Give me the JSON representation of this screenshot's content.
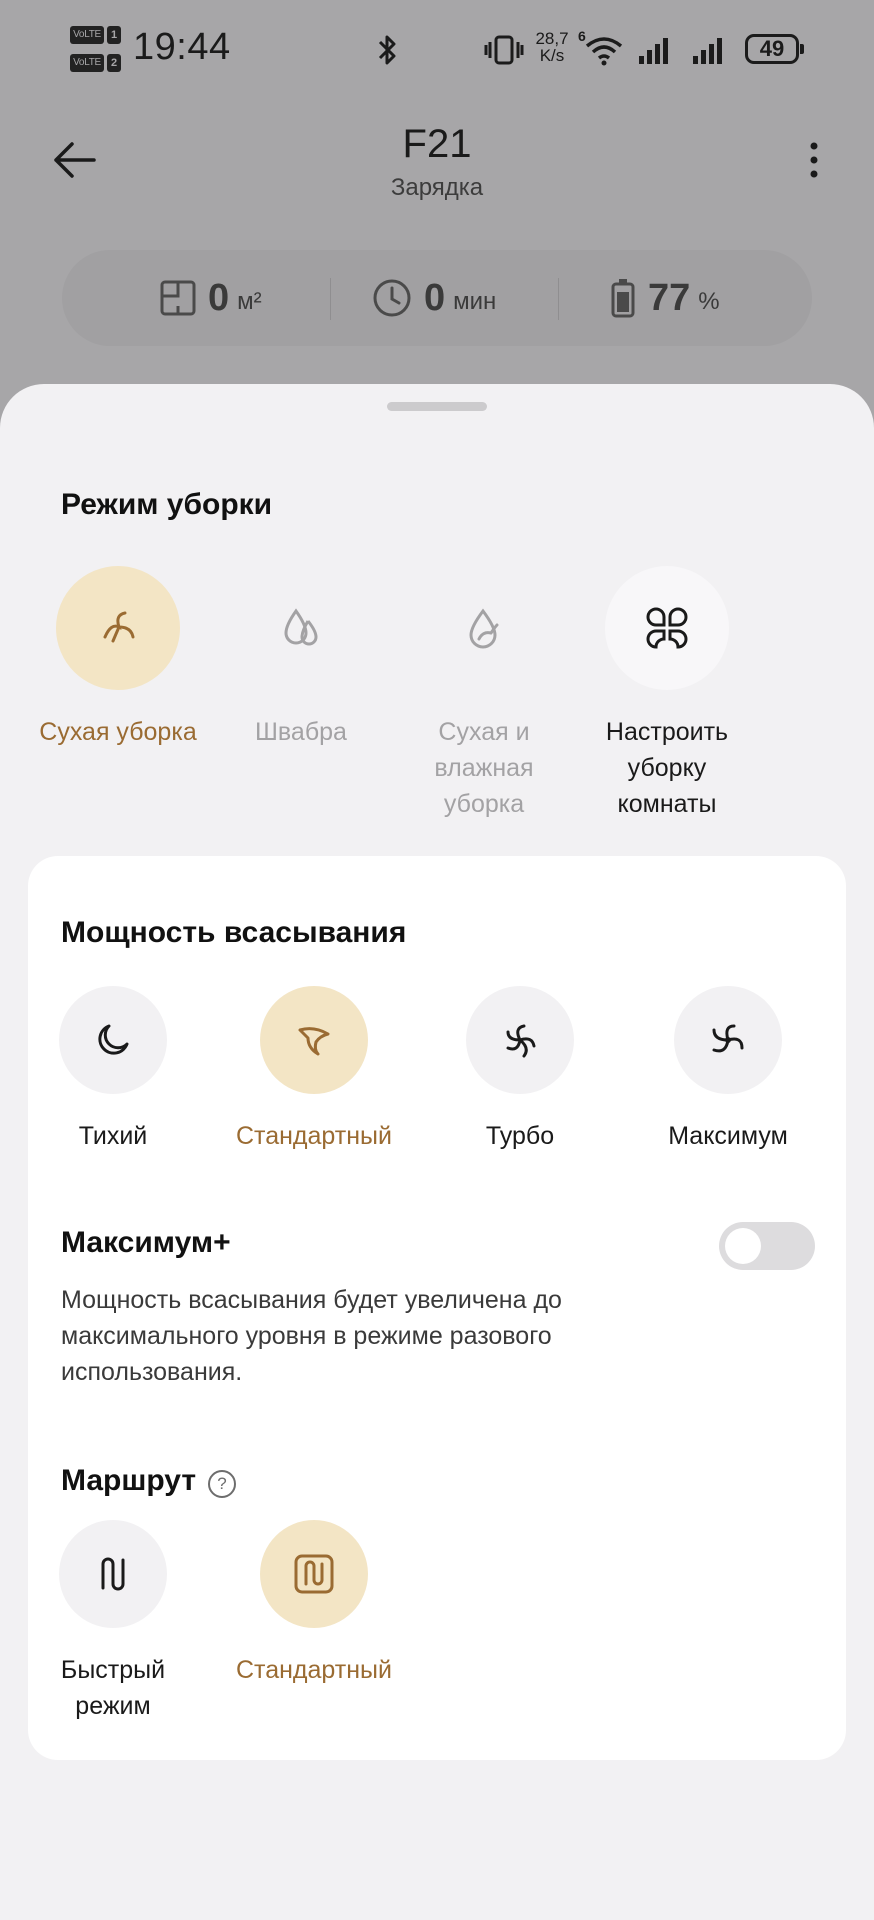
{
  "status_bar": {
    "sim1_tag": "VoLTE",
    "sim1_num": "1",
    "sim2_tag": "VoLTE",
    "sim2_num": "2",
    "time": "19:44",
    "net_speed_value": "28,7",
    "net_speed_unit": "K/s",
    "wifi_tag": "6",
    "battery": "49"
  },
  "header": {
    "title": "F21",
    "subtitle": "Зарядка"
  },
  "stats": {
    "area_value": "0",
    "area_unit": "м²",
    "time_value": "0",
    "time_unit": "мин",
    "battery_value": "77",
    "battery_unit": "%"
  },
  "cleaning_mode": {
    "title": "Режим уборки",
    "options": [
      {
        "label": "Сухая уборка",
        "icon": "dry-clean-icon",
        "state": "selected"
      },
      {
        "label": "Швабра",
        "icon": "mop-icon",
        "state": "disabled"
      },
      {
        "label": "Сухая и влажная уборка",
        "icon": "dry-wet-icon",
        "state": "disabled"
      },
      {
        "label": "Настроить уборку комнаты",
        "icon": "custom-room-icon",
        "state": "normal"
      }
    ]
  },
  "suction": {
    "title": "Мощность всасывания",
    "options": [
      {
        "label": "Тихий",
        "icon": "quiet-icon",
        "state": "normal"
      },
      {
        "label": "Стандартный",
        "icon": "standard-fan-icon",
        "state": "selected"
      },
      {
        "label": "Турбо",
        "icon": "turbo-fan-icon",
        "state": "normal"
      },
      {
        "label": "Максимум",
        "icon": "max-fan-icon",
        "state": "normal"
      }
    ]
  },
  "max_plus": {
    "title": "Максимум+",
    "enabled": false,
    "description": "Мощность всасывания будет увеличена до максимального уровня в режиме разового использования."
  },
  "route": {
    "title": "Маршрут",
    "help_glyph": "?",
    "options": [
      {
        "label": "Быстрый режим",
        "icon": "fast-route-icon",
        "state": "normal"
      },
      {
        "label": "Стандартный",
        "icon": "standard-route-icon",
        "state": "selected"
      }
    ]
  },
  "colors": {
    "accent": "#9a6b32",
    "selected_bg": "#f3e5c5",
    "option_bg": "#f2f1f3",
    "sheet_bg": "#f2f1f3",
    "card_bg": "#ffffff",
    "dim_overlay": "#a7a6a8"
  }
}
